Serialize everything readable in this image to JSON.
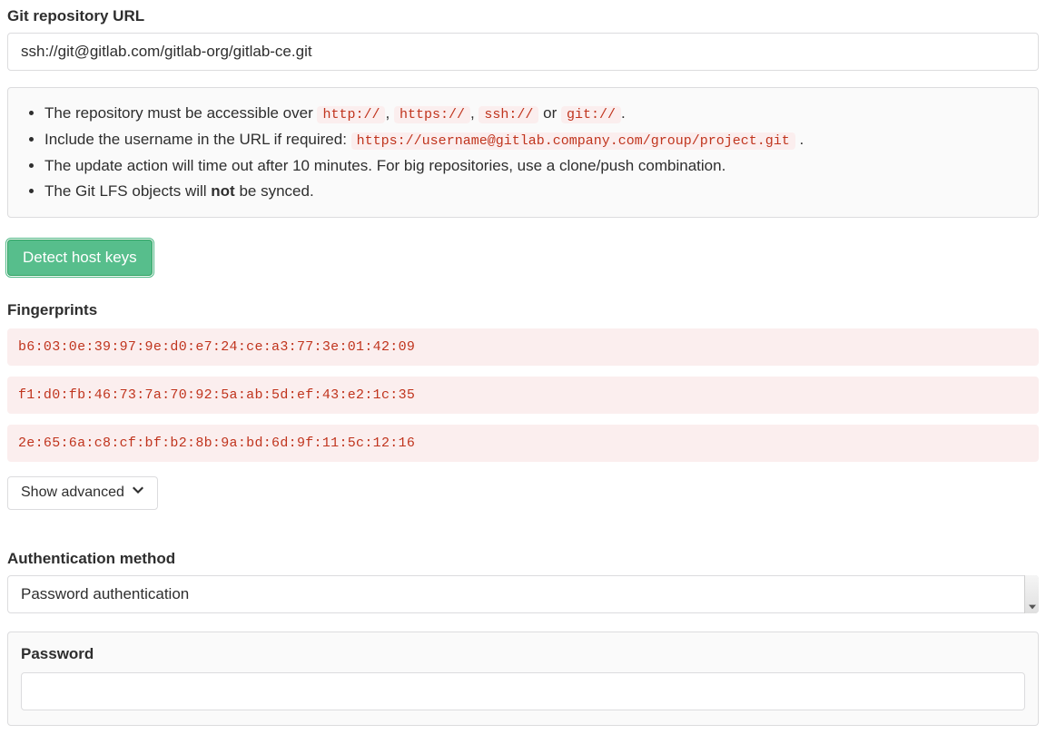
{
  "repo": {
    "label": "Git repository URL",
    "value": "ssh://git@gitlab.com/gitlab-org/gitlab-ce.git"
  },
  "hints": {
    "line1_pre": "The repository must be accessible over ",
    "line1_c1": "http://",
    "line1_s1": ", ",
    "line1_c2": "https://",
    "line1_s2": ", ",
    "line1_c3": "ssh://",
    "line1_s3": " or ",
    "line1_c4": "git://",
    "line1_post": ".",
    "line2_pre": "Include the username in the URL if required: ",
    "line2_code": "https://username@gitlab.company.com/group/project.git",
    "line2_post": " .",
    "line3": "The update action will time out after 10 minutes. For big repositories, use a clone/push combination.",
    "line4_pre": "The Git LFS objects will ",
    "line4_bold": "not",
    "line4_post": " be synced."
  },
  "detect_btn": "Detect host keys",
  "fingerprints": {
    "title": "Fingerprints",
    "items": [
      "b6:03:0e:39:97:9e:d0:e7:24:ce:a3:77:3e:01:42:09",
      "f1:d0:fb:46:73:7a:70:92:5a:ab:5d:ef:43:e2:1c:35",
      "2e:65:6a:c8:cf:bf:b2:8b:9a:bd:6d:9f:11:5c:12:16"
    ]
  },
  "show_advanced": "Show advanced",
  "auth": {
    "label": "Authentication method",
    "selected": "Password authentication"
  },
  "password": {
    "label": "Password",
    "value": ""
  }
}
